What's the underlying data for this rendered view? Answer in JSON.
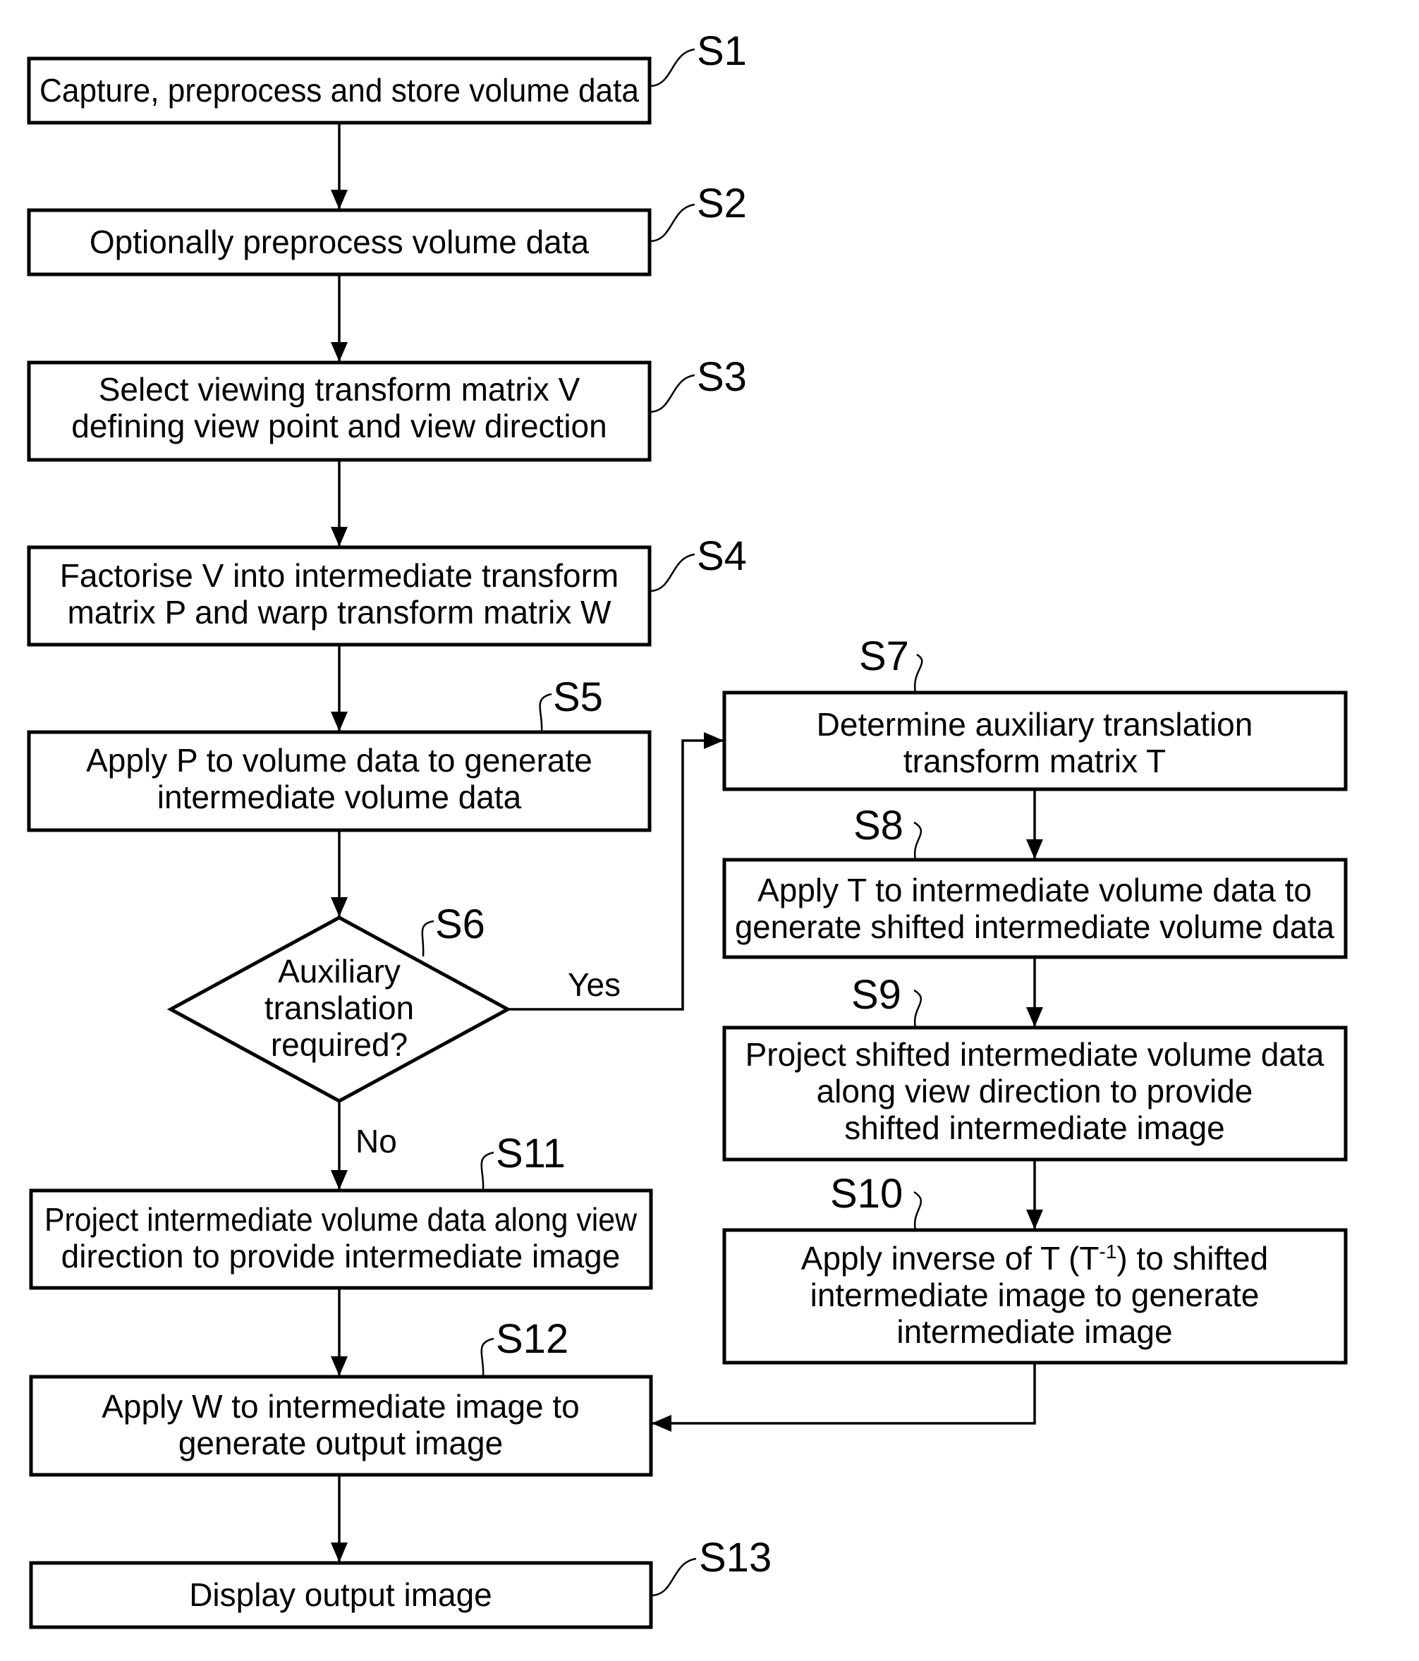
{
  "diagram": {
    "type": "flowchart",
    "steps": [
      {
        "id": "S1",
        "label": "S1",
        "lines": [
          "Capture, preprocess and store volume data"
        ]
      },
      {
        "id": "S2",
        "label": "S2",
        "lines": [
          "Optionally preprocess volume data"
        ]
      },
      {
        "id": "S3",
        "label": "S3",
        "lines": [
          "Select viewing transform matrix V",
          "defining view point and view direction"
        ]
      },
      {
        "id": "S4",
        "label": "S4",
        "lines": [
          "Factorise V into intermediate transform",
          "matrix P and warp transform matrix W"
        ]
      },
      {
        "id": "S5",
        "label": "S5",
        "lines": [
          "Apply P to volume data to generate",
          "intermediate volume data"
        ]
      },
      {
        "id": "S6",
        "label": "S6",
        "lines": [
          "Auxiliary",
          "translation",
          "required?"
        ],
        "shape": "decision"
      },
      {
        "id": "S7",
        "label": "S7",
        "lines": [
          "Determine auxiliary translation",
          "transform matrix T"
        ]
      },
      {
        "id": "S8",
        "label": "S8",
        "lines": [
          "Apply T to intermediate volume data to",
          "generate shifted intermediate volume data"
        ]
      },
      {
        "id": "S9",
        "label": "S9",
        "lines": [
          "Project shifted intermediate volume data",
          "along view direction to provide",
          "shifted intermediate image"
        ]
      },
      {
        "id": "S10",
        "label": "S10",
        "lines": [
          "Apply inverse of T (T",
          "-1",
          ") to shifted",
          "intermediate image to generate",
          "intermediate image"
        ]
      },
      {
        "id": "S11",
        "label": "S11",
        "lines": [
          "Project intermediate volume data along view",
          "direction to provide intermediate image"
        ]
      },
      {
        "id": "S12",
        "label": "S12",
        "lines": [
          "Apply W to intermediate image to",
          "generate output image"
        ]
      },
      {
        "id": "S13",
        "label": "S13",
        "lines": [
          "Display output image"
        ]
      }
    ],
    "branches": {
      "yes": "Yes",
      "no": "No"
    },
    "edges": [
      [
        "S1",
        "S2"
      ],
      [
        "S2",
        "S3"
      ],
      [
        "S3",
        "S4"
      ],
      [
        "S4",
        "S5"
      ],
      [
        "S5",
        "S6"
      ],
      [
        "S6",
        "S7",
        "Yes"
      ],
      [
        "S6",
        "S11",
        "No"
      ],
      [
        "S7",
        "S8"
      ],
      [
        "S8",
        "S9"
      ],
      [
        "S9",
        "S10"
      ],
      [
        "S10",
        "S12"
      ],
      [
        "S11",
        "S12"
      ],
      [
        "S12",
        "S13"
      ]
    ]
  }
}
